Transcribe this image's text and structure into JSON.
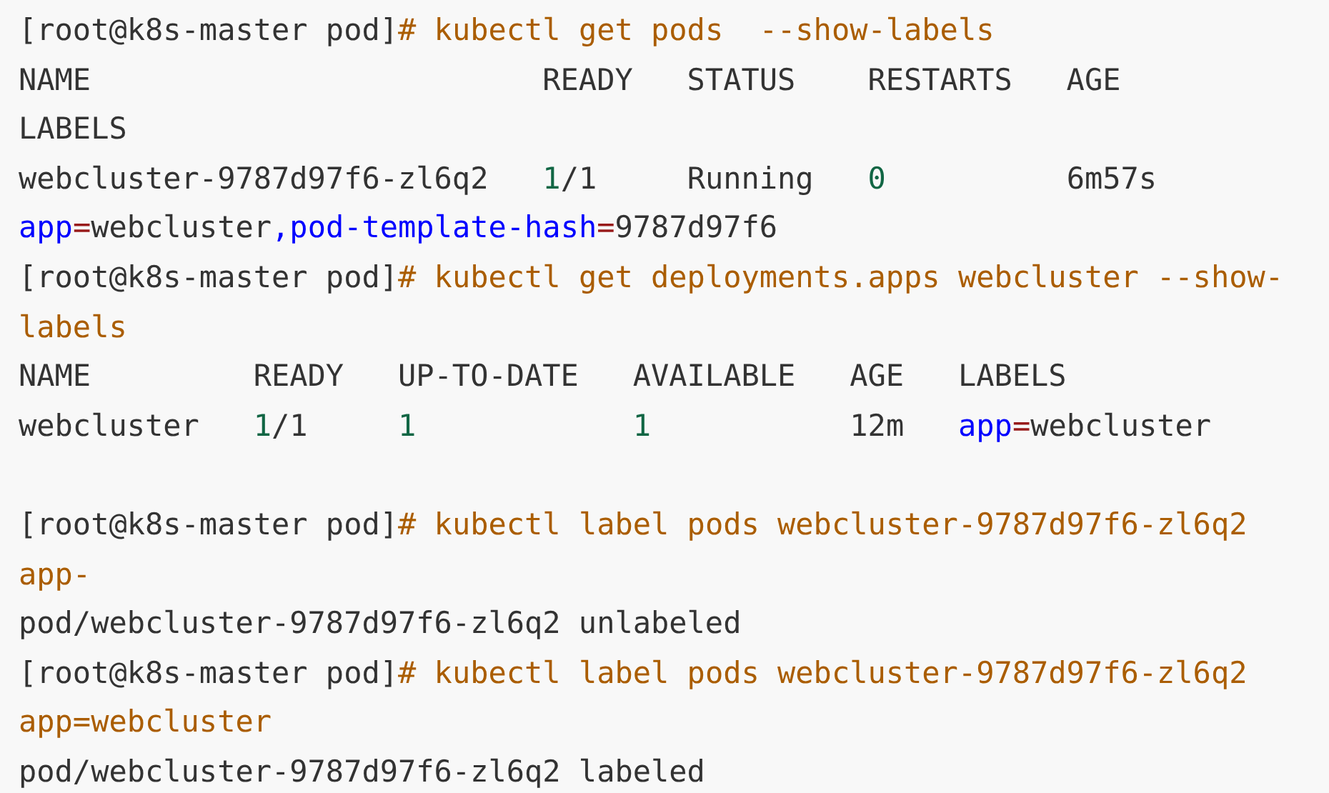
{
  "code_block": {
    "lines": [
      {
        "tokens": [
          {
            "text": "[root@k8s-master pod]",
            "kind": "plain"
          },
          {
            "text": "# kubectl get pods  --show-labels",
            "kind": "keyword"
          }
        ]
      },
      {
        "tokens": [
          {
            "text": "NAME                         READY   STATUS    RESTARTS   AGE",
            "kind": "plain"
          }
        ]
      },
      {
        "tokens": [
          {
            "text": "LABELS",
            "kind": "plain"
          }
        ]
      },
      {
        "tokens": [
          {
            "text": "webcluster-9787d97f6-zl6q2   ",
            "kind": "plain"
          },
          {
            "text": "1",
            "kind": "number"
          },
          {
            "text": "/1     Running   ",
            "kind": "plain"
          },
          {
            "text": "0",
            "kind": "number"
          },
          {
            "text": "          6m57s",
            "kind": "plain"
          }
        ]
      },
      {
        "tokens": [
          {
            "text": "app",
            "kind": "attr"
          },
          {
            "text": "=",
            "kind": "operator"
          },
          {
            "text": "webcluster",
            "kind": "plain"
          },
          {
            "text": ",pod-template-hash",
            "kind": "attr"
          },
          {
            "text": "=",
            "kind": "operator"
          },
          {
            "text": "9787d97f6",
            "kind": "plain"
          }
        ]
      },
      {
        "tokens": [
          {
            "text": "[root@k8s-master pod]",
            "kind": "plain"
          },
          {
            "text": "# kubectl get deployments.apps webcluster --show-",
            "kind": "keyword"
          }
        ]
      },
      {
        "tokens": [
          {
            "text": "labels",
            "kind": "keyword"
          }
        ]
      },
      {
        "tokens": [
          {
            "text": "NAME         READY   UP-TO-DATE   AVAILABLE   AGE   LABELS",
            "kind": "plain"
          }
        ]
      },
      {
        "tokens": [
          {
            "text": "webcluster   ",
            "kind": "plain"
          },
          {
            "text": "1",
            "kind": "number"
          },
          {
            "text": "/1     ",
            "kind": "plain"
          },
          {
            "text": "1            ",
            "kind": "number"
          },
          {
            "text": "1",
            "kind": "number"
          },
          {
            "text": "           12m   ",
            "kind": "plain"
          },
          {
            "text": "app",
            "kind": "attr"
          },
          {
            "text": "=",
            "kind": "operator"
          },
          {
            "text": "webcluster",
            "kind": "plain"
          }
        ]
      },
      {
        "kind": "blank"
      },
      {
        "tokens": [
          {
            "text": "[root@k8s-master pod]",
            "kind": "plain"
          },
          {
            "text": "# kubectl label pods webcluster-9787d97f6-zl6q2",
            "kind": "keyword"
          }
        ]
      },
      {
        "tokens": [
          {
            "text": "app-",
            "kind": "keyword"
          }
        ]
      },
      {
        "tokens": [
          {
            "text": "pod/webcluster-9787d97f6-zl6q2 unlabeled",
            "kind": "plain"
          }
        ]
      },
      {
        "tokens": [
          {
            "text": "[root@k8s-master pod]",
            "kind": "plain"
          },
          {
            "text": "# kubectl label pods webcluster-9787d97f6-zl6q2",
            "kind": "keyword"
          }
        ]
      },
      {
        "tokens": [
          {
            "text": "app=webcluster",
            "kind": "keyword"
          }
        ]
      },
      {
        "tokens": [
          {
            "text": "pod/webcluster-9787d97f6-zl6q2 labeled",
            "kind": "plain"
          }
        ]
      }
    ]
  }
}
